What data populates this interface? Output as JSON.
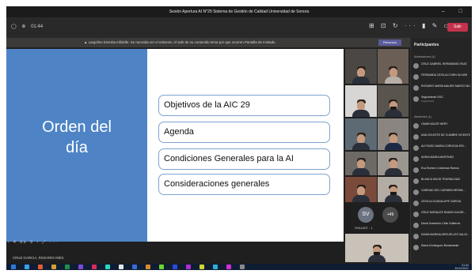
{
  "window": {
    "title": "Sesión Apertura AI N°29 Sistema de Gestión de Calidad Universidad de Sonora",
    "controls": "– □"
  },
  "toolbar": {
    "left_items": [
      "◯",
      "⊕",
      "01:44"
    ],
    "tools": "⊞ ⊡ ↻ ··· ▮ ✎ ▭",
    "hangup_label": "Salir"
  },
  "notification": {
    "message": "▲ Largeline Emerita Infidelle: Se necesita ver el sobreviv. Al salir de su contenido tema por que ocurren Pantalla de Invitado",
    "button_label": "Recursos"
  },
  "slide": {
    "heading": "Orden del\ndía",
    "agenda_items": [
      "Objetivos de la AIC 29",
      "Agenda",
      "Condiciones Generales para la AI",
      "Consideraciones generales"
    ],
    "controls": "‹ 4 de 9 › ⤢ ···",
    "presenter": "CRUZ GARCIA, ROSARIO INÉS"
  },
  "avatars": {
    "sv": {
      "initials": "SV",
      "label": "SVAUDIT - 1"
    },
    "more": {
      "initials": "+49",
      "label": ""
    }
  },
  "participants": {
    "title": "Participantes",
    "section_presenters": "Moderadores (4)",
    "section_attendees": "Asistentes (1)",
    "presenters": [
      {
        "name": "CRUZ GABRIEL HERNÁNDEZ RUIZ",
        "role": ""
      },
      {
        "name": "FERNANDA CECILIA CORN OLIVAR",
        "role": ""
      },
      {
        "name": "ROSARIO MARÍA MAURO MARCO BU...",
        "role": ""
      },
      {
        "name": "Seguimiento SGC",
        "role": "Organizador"
      }
    ],
    "attendees": [
      {
        "name": "OMAR ADLER NERY",
        "role": ""
      },
      {
        "name": "ANA CELESTE DE CUMBRE VICENTE...",
        "role": ""
      },
      {
        "name": "ALFONSO MARIA CORDOVA ERI...",
        "role": ""
      },
      {
        "name": "ADRIA MARIA MARTINEZ",
        "role": ""
      },
      {
        "name": "Eva Romero Cárdenas Ramos",
        "role": ""
      },
      {
        "name": "BLANCA DAVID TRUEBA DÍAZ",
        "role": ""
      },
      {
        "name": "CARIDAD DEL CARMEN HERNÁ...",
        "role": ""
      },
      {
        "name": "CECILIA GUADALUPE GARCÍA",
        "role": ""
      },
      {
        "name": "CRUZ MORALES RAMOS AGUIR...",
        "role": ""
      },
      {
        "name": "David Humberto Celis Gutiérrez",
        "role": ""
      },
      {
        "name": "DIANA MARINA ARGUELLES VALLE...",
        "role": ""
      },
      {
        "name": "Diana Dominguez Bustamante",
        "role": ""
      }
    ]
  },
  "taskbar": {
    "clock": "01:44\n10/12/2021"
  },
  "colors": {
    "slide_blue": "#4e84c6",
    "agenda_border": "#7ea4d1",
    "hangup_red": "#c4314b",
    "notify_button": "#5b5b9b"
  }
}
